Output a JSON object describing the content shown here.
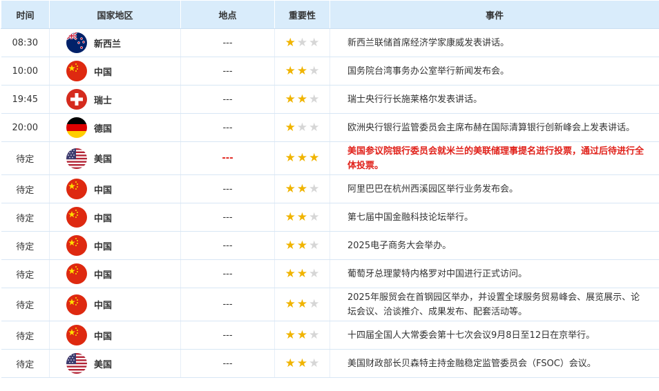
{
  "headers": {
    "time": "时间",
    "region": "国家地区",
    "location": "地点",
    "importance": "重要性",
    "event": "事件"
  },
  "colors": {
    "header_bg": "#d9ecfb",
    "star_on": "#f0b400",
    "star_off": "#d6d6d6",
    "highlight": "#e0211a"
  },
  "rows": [
    {
      "time": "08:30",
      "country": "新西兰",
      "flag": "nz",
      "location": "---",
      "stars": 1,
      "event": "新西兰联储首席经济学家康威发表讲话。",
      "highlight": false
    },
    {
      "time": "10:00",
      "country": "中国",
      "flag": "cn",
      "location": "---",
      "stars": 2,
      "event": "国务院台湾事务办公室举行新闻发布会。",
      "highlight": false
    },
    {
      "time": "19:45",
      "country": "瑞士",
      "flag": "ch",
      "location": "---",
      "stars": 2,
      "event": "瑞士央行行长施莱格尔发表讲话。",
      "highlight": false
    },
    {
      "time": "20:00",
      "country": "德国",
      "flag": "de",
      "location": "---",
      "stars": 1,
      "event": "欧洲央行银行监管委员会主席布赫在国际清算银行创新峰会上发表讲话。",
      "highlight": false
    },
    {
      "time": "待定",
      "country": "美国",
      "flag": "us",
      "location": "---",
      "stars": 3,
      "event": "美国参议院银行委员会就米兰的美联储理事提名进行投票，通过后待进行全体投票。",
      "highlight": true
    },
    {
      "time": "待定",
      "country": "中国",
      "flag": "cn",
      "location": "---",
      "stars": 2,
      "event": "阿里巴巴在杭州西溪园区举行业务发布会。",
      "highlight": false
    },
    {
      "time": "待定",
      "country": "中国",
      "flag": "cn",
      "location": "---",
      "stars": 2,
      "event": "第七届中国金融科技论坛举行。",
      "highlight": false
    },
    {
      "time": "待定",
      "country": "中国",
      "flag": "cn",
      "location": "---",
      "stars": 2,
      "event": "2025电子商务大会举办。",
      "highlight": false
    },
    {
      "time": "待定",
      "country": "中国",
      "flag": "cn",
      "location": "---",
      "stars": 2,
      "event": "葡萄牙总理蒙特内格罗对中国进行正式访问。",
      "highlight": false
    },
    {
      "time": "待定",
      "country": "中国",
      "flag": "cn",
      "location": "---",
      "stars": 2,
      "event": "2025年服贸会在首钢园区举办，并设置全球服务贸易峰会、展览展示、论坛会议、洽谈推介、成果发布、配套活动等。",
      "highlight": false
    },
    {
      "time": "待定",
      "country": "中国",
      "flag": "cn",
      "location": "---",
      "stars": 2,
      "event": "十四届全国人大常委会第十七次会议9月8日至12日在京举行。",
      "highlight": false
    },
    {
      "time": "待定",
      "country": "美国",
      "flag": "us",
      "location": "---",
      "stars": 2,
      "event": "美国财政部长贝森特主持金融稳定监管委员会（FSOC）会议。",
      "highlight": false
    }
  ]
}
